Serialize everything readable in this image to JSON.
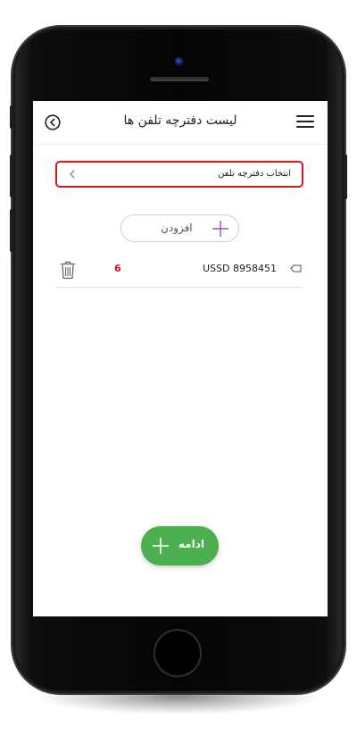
{
  "header": {
    "title": "لیست دفترچه تلفن ها",
    "back_icon": "back-circle-icon",
    "menu_icon": "hamburger-menu-icon"
  },
  "phonebook_select": {
    "label": "انتخاب دفترچه تلفن",
    "border_color": "#d7141c"
  },
  "add_button": {
    "label": "افزودن",
    "icon": "plus-icon",
    "icon_color": "#9c27b0"
  },
  "items": [
    {
      "name": "USSD 8958451",
      "count": "6"
    }
  ],
  "continue_button": {
    "label": "ادامه",
    "color": "#4caf50"
  }
}
